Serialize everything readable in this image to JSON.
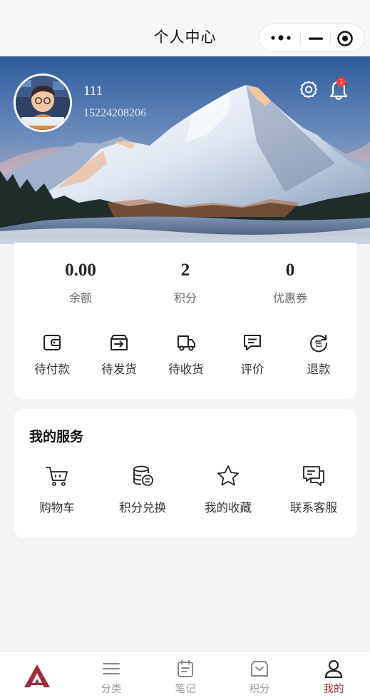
{
  "navbar": {
    "title": "个人中心"
  },
  "user": {
    "name": "111",
    "phone": "15224208206",
    "notification_count": "1"
  },
  "stats": [
    {
      "value": "0.00",
      "label": "余额"
    },
    {
      "value": "2",
      "label": "积分"
    },
    {
      "value": "0",
      "label": "优惠券"
    }
  ],
  "orders": [
    {
      "label": "待付款",
      "icon": "wallet-icon"
    },
    {
      "label": "待发货",
      "icon": "package-out-icon"
    },
    {
      "label": "待收货",
      "icon": "truck-icon"
    },
    {
      "label": "评价",
      "icon": "comment-icon"
    },
    {
      "label": "退款",
      "icon": "refund-icon"
    }
  ],
  "services": {
    "title": "我的服务",
    "items": [
      {
        "label": "购物车",
        "icon": "cart-icon"
      },
      {
        "label": "积分兑换",
        "icon": "coins-icon"
      },
      {
        "label": "我的收藏",
        "icon": "star-icon"
      },
      {
        "label": "联系客服",
        "icon": "chat-icon"
      }
    ]
  },
  "tabbar": {
    "items": [
      {
        "label": "",
        "icon": "brand-logo"
      },
      {
        "label": "分类",
        "icon": "menu-icon"
      },
      {
        "label": "笔记",
        "icon": "note-icon"
      },
      {
        "label": "积分",
        "icon": "points-icon"
      },
      {
        "label": "我的",
        "icon": "user-icon",
        "active": true
      }
    ]
  },
  "colors": {
    "accent": "#9e2a3a",
    "background": "#f4f4f4",
    "badge": "#ff3b30"
  }
}
